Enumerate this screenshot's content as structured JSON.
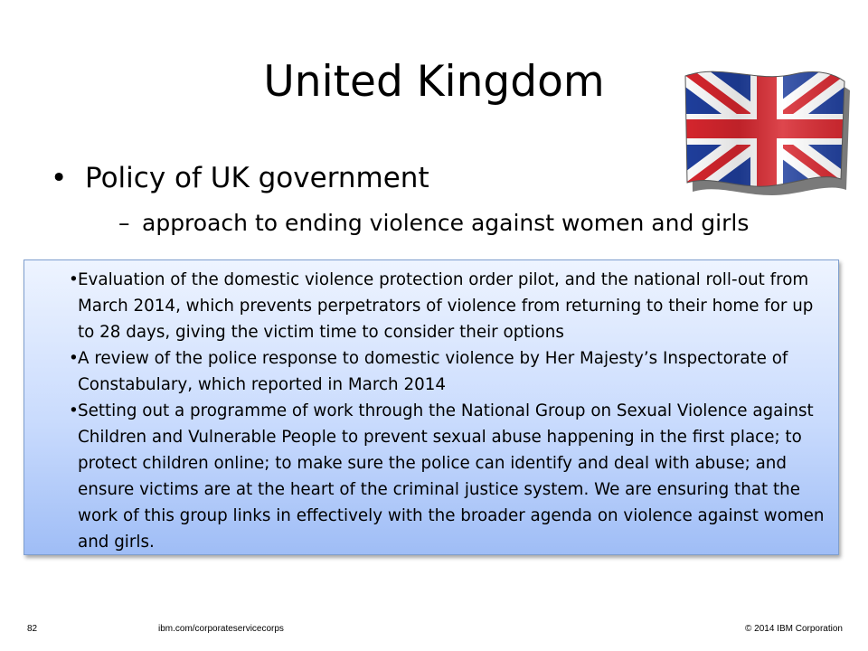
{
  "slide": {
    "title": "United Kingdom",
    "bullet_main": "Policy of UK government",
    "bullet_sub": "approach to ending violence against women and girls",
    "flag_icon": "union-jack-flag"
  },
  "box": {
    "items": [
      "Evaluation of the domestic violence protection order pilot, and the national roll-out from March 2014, which prevents perpetrators of violence from returning to their home for up to 28 days, giving the victim time to consider their options",
      "A review of the police response to domestic violence by Her Majesty’s Inspectorate of Constabulary, which reported in March 2014",
      "Setting  out a programme of work through the National Group on Sexual Violence against Children and Vulnerable People to prevent sexual abuse happening in the first place; to protect children online; to make sure the police can identify and deal with abuse; and ensure victims are at the heart of the criminal justice system. We are ensuring that the work of this group links in effectively with the broader agenda on violence against women and girls."
    ]
  },
  "footer": {
    "page_number": "82",
    "url": "ibm.com/corporateservicecorps",
    "copyright": "© 2014 IBM  Corporation"
  },
  "colors": {
    "flag_blue": "#1f3f9e",
    "flag_red": "#d8262e",
    "box_top": "#eef4ff",
    "box_bottom": "#9fbdf6"
  }
}
